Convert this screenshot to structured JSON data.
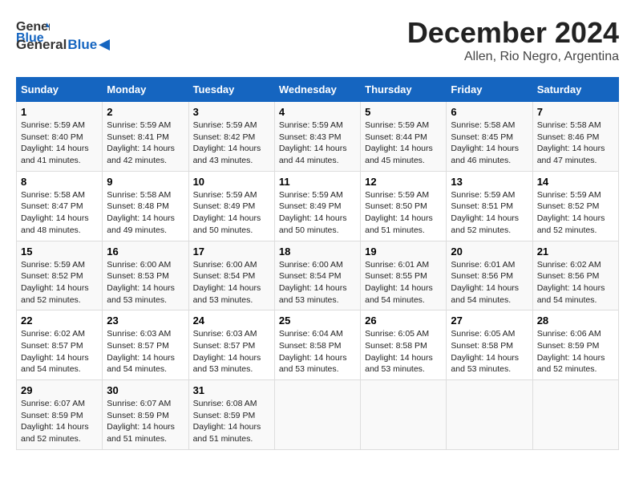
{
  "header": {
    "logo_general": "General",
    "logo_blue": "Blue",
    "title": "December 2024",
    "subtitle": "Allen, Rio Negro, Argentina"
  },
  "calendar": {
    "days_of_week": [
      "Sunday",
      "Monday",
      "Tuesday",
      "Wednesday",
      "Thursday",
      "Friday",
      "Saturday"
    ],
    "weeks": [
      [
        {
          "day": "1",
          "sunrise": "5:59 AM",
          "sunset": "8:40 PM",
          "daylight": "14 hours and 41 minutes."
        },
        {
          "day": "2",
          "sunrise": "5:59 AM",
          "sunset": "8:41 PM",
          "daylight": "14 hours and 42 minutes."
        },
        {
          "day": "3",
          "sunrise": "5:59 AM",
          "sunset": "8:42 PM",
          "daylight": "14 hours and 43 minutes."
        },
        {
          "day": "4",
          "sunrise": "5:59 AM",
          "sunset": "8:43 PM",
          "daylight": "14 hours and 44 minutes."
        },
        {
          "day": "5",
          "sunrise": "5:59 AM",
          "sunset": "8:44 PM",
          "daylight": "14 hours and 45 minutes."
        },
        {
          "day": "6",
          "sunrise": "5:58 AM",
          "sunset": "8:45 PM",
          "daylight": "14 hours and 46 minutes."
        },
        {
          "day": "7",
          "sunrise": "5:58 AM",
          "sunset": "8:46 PM",
          "daylight": "14 hours and 47 minutes."
        }
      ],
      [
        {
          "day": "8",
          "sunrise": "5:58 AM",
          "sunset": "8:47 PM",
          "daylight": "14 hours and 48 minutes."
        },
        {
          "day": "9",
          "sunrise": "5:58 AM",
          "sunset": "8:48 PM",
          "daylight": "14 hours and 49 minutes."
        },
        {
          "day": "10",
          "sunrise": "5:59 AM",
          "sunset": "8:49 PM",
          "daylight": "14 hours and 50 minutes."
        },
        {
          "day": "11",
          "sunrise": "5:59 AM",
          "sunset": "8:49 PM",
          "daylight": "14 hours and 50 minutes."
        },
        {
          "day": "12",
          "sunrise": "5:59 AM",
          "sunset": "8:50 PM",
          "daylight": "14 hours and 51 minutes."
        },
        {
          "day": "13",
          "sunrise": "5:59 AM",
          "sunset": "8:51 PM",
          "daylight": "14 hours and 52 minutes."
        },
        {
          "day": "14",
          "sunrise": "5:59 AM",
          "sunset": "8:52 PM",
          "daylight": "14 hours and 52 minutes."
        }
      ],
      [
        {
          "day": "15",
          "sunrise": "5:59 AM",
          "sunset": "8:52 PM",
          "daylight": "14 hours and 52 minutes."
        },
        {
          "day": "16",
          "sunrise": "6:00 AM",
          "sunset": "8:53 PM",
          "daylight": "14 hours and 53 minutes."
        },
        {
          "day": "17",
          "sunrise": "6:00 AM",
          "sunset": "8:54 PM",
          "daylight": "14 hours and 53 minutes."
        },
        {
          "day": "18",
          "sunrise": "6:00 AM",
          "sunset": "8:54 PM",
          "daylight": "14 hours and 53 minutes."
        },
        {
          "day": "19",
          "sunrise": "6:01 AM",
          "sunset": "8:55 PM",
          "daylight": "14 hours and 54 minutes."
        },
        {
          "day": "20",
          "sunrise": "6:01 AM",
          "sunset": "8:56 PM",
          "daylight": "14 hours and 54 minutes."
        },
        {
          "day": "21",
          "sunrise": "6:02 AM",
          "sunset": "8:56 PM",
          "daylight": "14 hours and 54 minutes."
        }
      ],
      [
        {
          "day": "22",
          "sunrise": "6:02 AM",
          "sunset": "8:57 PM",
          "daylight": "14 hours and 54 minutes."
        },
        {
          "day": "23",
          "sunrise": "6:03 AM",
          "sunset": "8:57 PM",
          "daylight": "14 hours and 54 minutes."
        },
        {
          "day": "24",
          "sunrise": "6:03 AM",
          "sunset": "8:57 PM",
          "daylight": "14 hours and 53 minutes."
        },
        {
          "day": "25",
          "sunrise": "6:04 AM",
          "sunset": "8:58 PM",
          "daylight": "14 hours and 53 minutes."
        },
        {
          "day": "26",
          "sunrise": "6:05 AM",
          "sunset": "8:58 PM",
          "daylight": "14 hours and 53 minutes."
        },
        {
          "day": "27",
          "sunrise": "6:05 AM",
          "sunset": "8:58 PM",
          "daylight": "14 hours and 53 minutes."
        },
        {
          "day": "28",
          "sunrise": "6:06 AM",
          "sunset": "8:59 PM",
          "daylight": "14 hours and 52 minutes."
        }
      ],
      [
        {
          "day": "29",
          "sunrise": "6:07 AM",
          "sunset": "8:59 PM",
          "daylight": "14 hours and 52 minutes."
        },
        {
          "day": "30",
          "sunrise": "6:07 AM",
          "sunset": "8:59 PM",
          "daylight": "14 hours and 51 minutes."
        },
        {
          "day": "31",
          "sunrise": "6:08 AM",
          "sunset": "8:59 PM",
          "daylight": "14 hours and 51 minutes."
        },
        null,
        null,
        null,
        null
      ]
    ]
  }
}
